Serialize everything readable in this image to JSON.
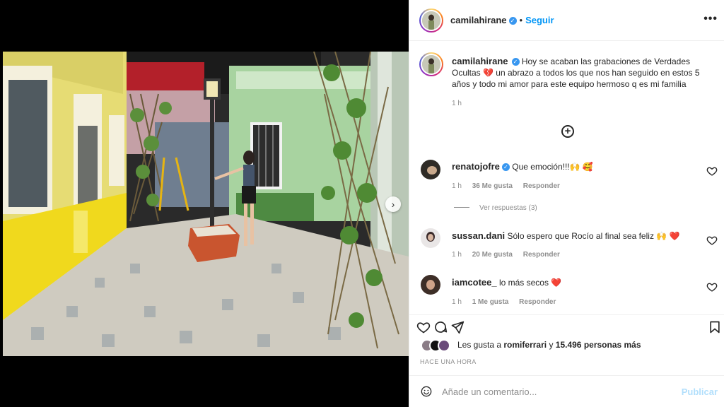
{
  "post": {
    "username": "camilahirane",
    "follow_label": "Seguir",
    "more_label": "•••",
    "caption": "Hoy se acaban las grabaciones de Verdades Ocultas 💔 un abrazo a todos los que nos han seguido en estos 5 años y todo mi amor para este equipo hermoso q es mi familia",
    "caption_time": "1 h",
    "likes_prefix": "Les gusta a",
    "likes_user": "romiferrari",
    "likes_conj": "y",
    "likes_count": "15.496 personas más",
    "time_ago": "HACE UNA HORA"
  },
  "media": {
    "next_label": "›"
  },
  "comments": [
    {
      "username": "renatojofre",
      "verified": true,
      "text": "Que emoción!!!🙌 🥰",
      "time": "1 h",
      "likes": "36 Me gusta",
      "reply": "Responder"
    },
    {
      "username": "sussan.dani",
      "verified": false,
      "text": "Sólo espero que Rocío al final sea feliz 🙌 ❤️",
      "time": "1 h",
      "likes": "20 Me gusta",
      "reply": "Responder"
    },
    {
      "username": "iamcotee_",
      "verified": false,
      "text": "lo más secos ❤️",
      "time": "1 h",
      "likes": "1 Me gusta",
      "reply": "Responder"
    }
  ],
  "view_replies": "Ver respuestas (3)",
  "add_comment": {
    "placeholder": "Añade un comentario...",
    "publish_label": "Publicar"
  },
  "colors": {
    "link_blue": "#0095f6",
    "verified_blue": "#3897f0",
    "heart_red": "#ed4956",
    "muted": "#8e8e8e"
  }
}
